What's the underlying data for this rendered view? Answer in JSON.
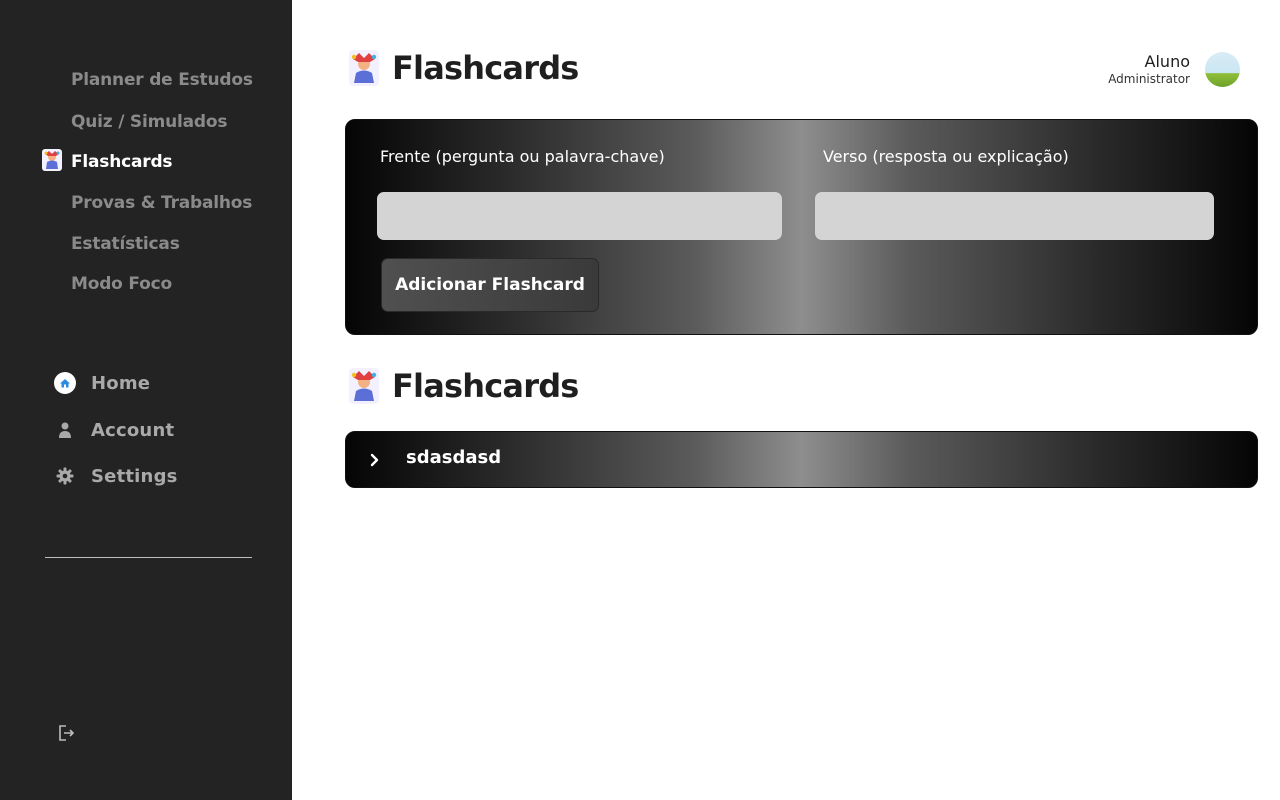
{
  "sidebar": {
    "nav": [
      {
        "label": "Planner de Estudos",
        "active": false
      },
      {
        "label": "Quiz / Simulados",
        "active": false
      },
      {
        "label": "Flashcards",
        "active": true
      },
      {
        "label": "Provas & Trabalhos",
        "active": false
      },
      {
        "label": "Estatísticas",
        "active": false
      },
      {
        "label": "Modo Foco",
        "active": false
      }
    ],
    "secondary": [
      {
        "label": "Home",
        "icon": "home-icon"
      },
      {
        "label": "Account",
        "icon": "user-icon"
      },
      {
        "label": "Settings",
        "icon": "gear-icon"
      }
    ],
    "logout_icon": "logout-icon"
  },
  "header": {
    "title": "Flashcards",
    "user_name": "Aluno",
    "user_role": "Administrator"
  },
  "form": {
    "front_label": "Frente (pergunta ou palavra-chave)",
    "back_label": "Verso (resposta ou explicação)",
    "front_value": "",
    "back_value": "",
    "add_button": "Adicionar Flashcard"
  },
  "list": {
    "title": "Flashcards",
    "items": [
      {
        "label": "sdasdasd"
      }
    ]
  },
  "colors": {
    "sidebar_bg": "#232323",
    "accent_blue": "#2b8be0"
  }
}
